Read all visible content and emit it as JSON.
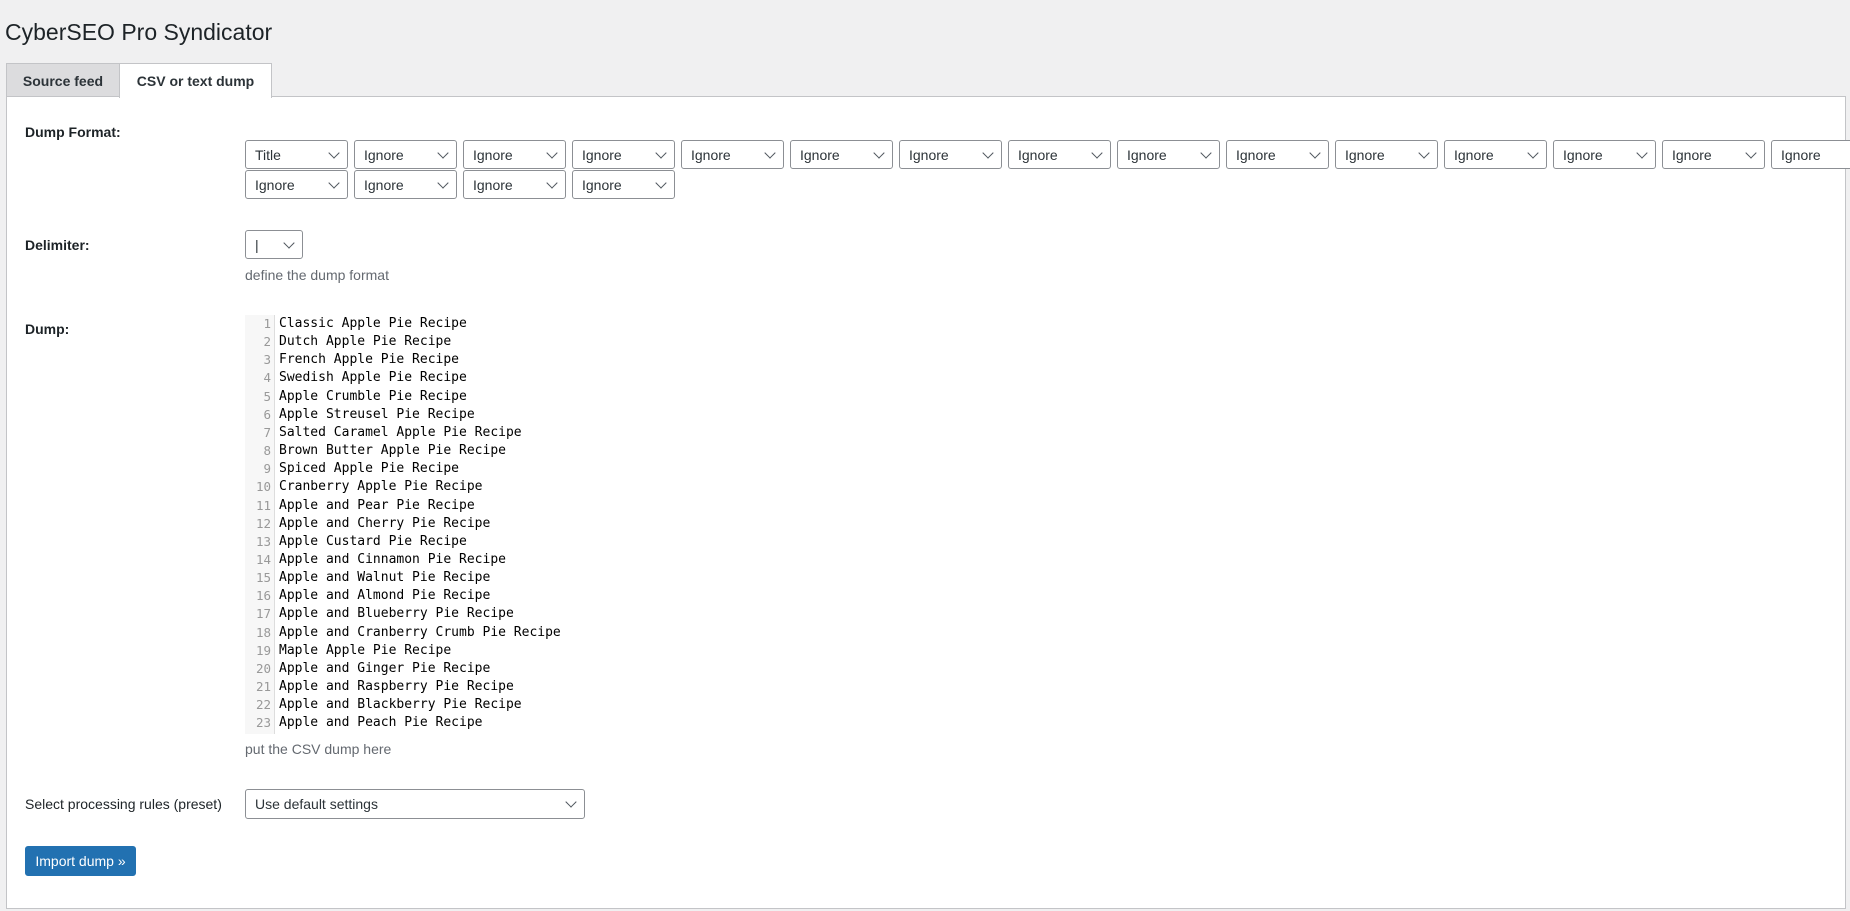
{
  "page_title": "CyberSEO Pro Syndicator",
  "tabs": [
    {
      "label": "Source feed",
      "active": false
    },
    {
      "label": "CSV or text dump",
      "active": true
    }
  ],
  "dump_format": {
    "label": "Dump Format:",
    "columns": [
      "Title",
      "Ignore",
      "Ignore",
      "Ignore",
      "Ignore",
      "Ignore",
      "Ignore",
      "Ignore",
      "Ignore",
      "Ignore",
      "Ignore",
      "Ignore",
      "Ignore",
      "Ignore",
      "Ignore",
      "Ignore",
      "Ignore",
      "Ignore",
      "Ignore"
    ]
  },
  "delimiter": {
    "label": "Delimiter:",
    "value": "|",
    "help": "define the dump format"
  },
  "dump": {
    "label": "Dump:",
    "help": "put the CSV dump here",
    "lines": [
      "Classic Apple Pie Recipe",
      "Dutch Apple Pie Recipe",
      "French Apple Pie Recipe",
      "Swedish Apple Pie Recipe",
      "Apple Crumble Pie Recipe",
      "Apple Streusel Pie Recipe",
      "Salted Caramel Apple Pie Recipe",
      "Brown Butter Apple Pie Recipe",
      "Spiced Apple Pie Recipe",
      "Cranberry Apple Pie Recipe",
      "Apple and Pear Pie Recipe",
      "Apple and Cherry Pie Recipe",
      "Apple Custard Pie Recipe",
      "Apple and Cinnamon Pie Recipe",
      "Apple and Walnut Pie Recipe",
      "Apple and Almond Pie Recipe",
      "Apple and Blueberry Pie Recipe",
      "Apple and Cranberry Crumb Pie Recipe",
      "Maple Apple Pie Recipe",
      "Apple and Ginger Pie Recipe",
      "Apple and Raspberry Pie Recipe",
      "Apple and Blackberry Pie Recipe",
      "Apple and Peach Pie Recipe"
    ]
  },
  "preset": {
    "label": "Select processing rules (preset)",
    "value": "Use default settings"
  },
  "import_button": "Import dump »",
  "colors": {
    "primary": "#2271b1",
    "background": "#f0f0f1"
  }
}
